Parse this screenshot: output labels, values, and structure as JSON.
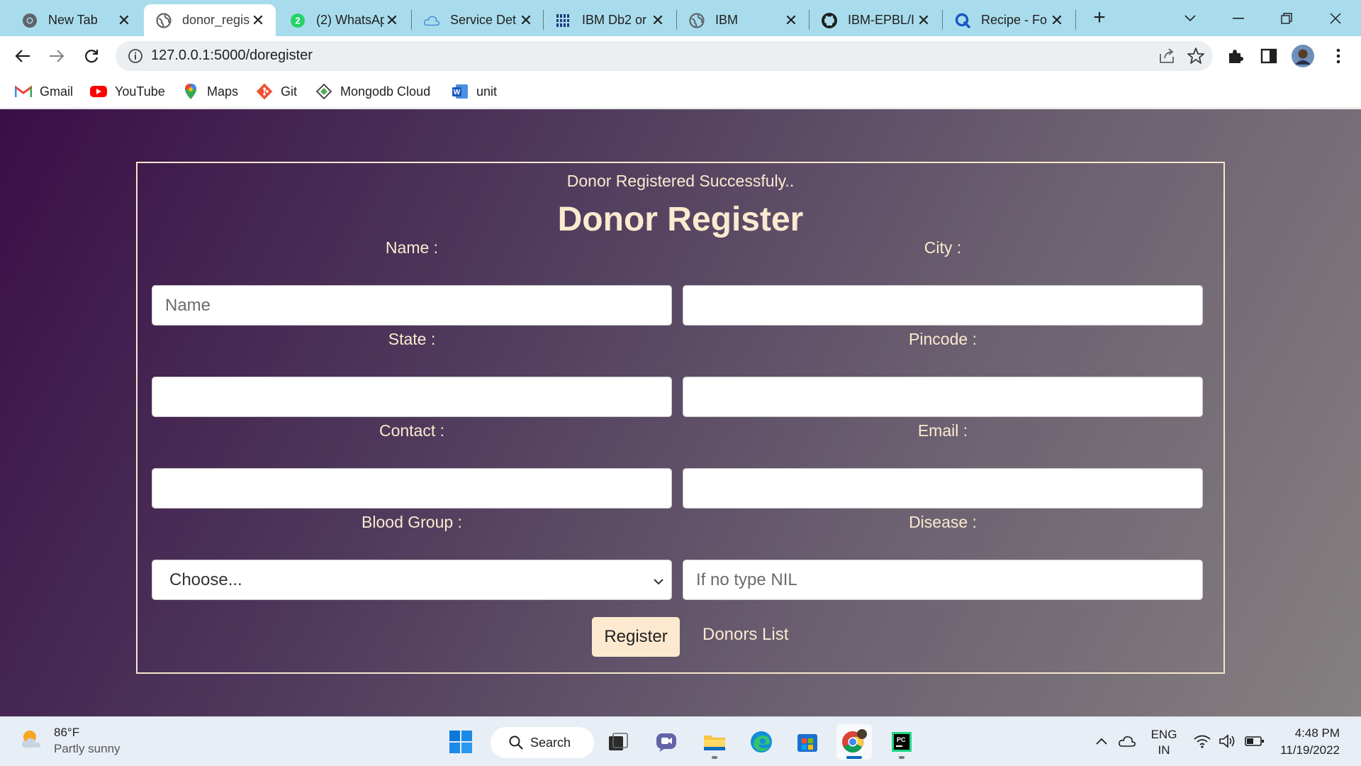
{
  "browser": {
    "tabs": [
      {
        "title": "New Tab",
        "icon": "chrome-icon"
      },
      {
        "title": "donor_regis",
        "icon": "globe-icon",
        "active": true
      },
      {
        "title": "(2) WhatsAp",
        "icon": "whatsapp-icon"
      },
      {
        "title": "Service Det",
        "icon": "cloud-icon"
      },
      {
        "title": "IBM Db2 or",
        "icon": "ibm-db2-icon"
      },
      {
        "title": "IBM",
        "icon": "globe-icon"
      },
      {
        "title": "IBM-EPBL/I",
        "icon": "github-icon"
      },
      {
        "title": "Recipe - Fo",
        "icon": "recipe-icon"
      }
    ],
    "new_tab_label": "+",
    "url": "127.0.0.1:5000/doregister",
    "bookmarks": [
      {
        "label": "Gmail",
        "icon": "gmail-icon"
      },
      {
        "label": "YouTube",
        "icon": "youtube-icon"
      },
      {
        "label": "Maps",
        "icon": "maps-icon"
      },
      {
        "label": "Git",
        "icon": "git-icon"
      },
      {
        "label": "Mongodb Cloud",
        "icon": "mongodb-icon"
      },
      {
        "label": "unit",
        "icon": "word-icon"
      }
    ]
  },
  "form": {
    "status_message": "Donor Registered Successfuly..",
    "title": "Donor Register",
    "fields": {
      "name": {
        "label": "Name :",
        "placeholder": "Name",
        "value": ""
      },
      "city": {
        "label": "City :",
        "placeholder": "",
        "value": ""
      },
      "state": {
        "label": "State :",
        "placeholder": "",
        "value": ""
      },
      "pincode": {
        "label": "Pincode :",
        "placeholder": "",
        "value": ""
      },
      "contact": {
        "label": "Contact :",
        "placeholder": "",
        "value": ""
      },
      "email": {
        "label": "Email :",
        "placeholder": "",
        "value": ""
      },
      "blood_group": {
        "label": "Blood Group :",
        "selected": "Choose..."
      },
      "disease": {
        "label": "Disease :",
        "placeholder": "If no type NIL",
        "value": ""
      }
    },
    "register_button": "Register",
    "donors_list_link": "Donors List"
  },
  "taskbar": {
    "weather": {
      "temp": "86°F",
      "condition": "Partly sunny"
    },
    "search_label": "Search",
    "language": {
      "line1": "ENG",
      "line2": "IN"
    },
    "clock": {
      "time": "4:48 PM",
      "date": "11/19/2022"
    }
  },
  "colors": {
    "tab_strip": "#a8dcec",
    "page_gradient_start": "#3a0e46",
    "page_gradient_end": "#858080",
    "cream_text": "#fbead0",
    "register_button": "#fce9cf"
  }
}
